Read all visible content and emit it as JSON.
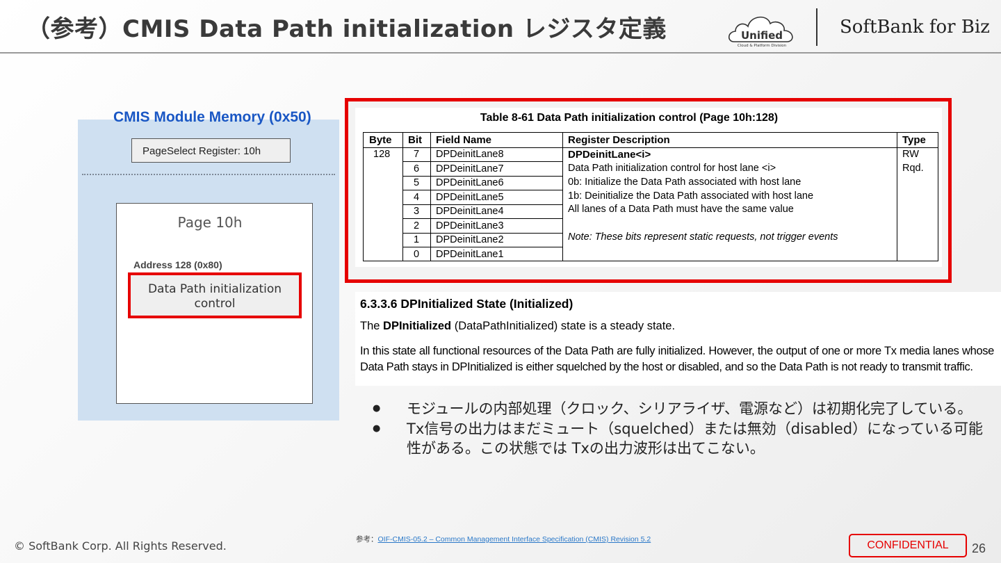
{
  "header": {
    "title": "（参考）CMIS Data Path initialization レジスタ定義",
    "logo_unified_text": "Unified",
    "logo_unified_sub": "Cloud & Platform Division",
    "logo_softbank": "SoftBank for Biz"
  },
  "memory_diagram": {
    "title": "CMIS Module Memory (0x50)",
    "pageselect": "PageSelect Register: 10h",
    "page_label": "Page 10h",
    "address_label": "Address 128 (0x80)",
    "box_lines": [
      "Data Path initialization",
      "control"
    ]
  },
  "register_table": {
    "caption": "Table 8-61 Data Path initialization control (Page 10h:128)",
    "headers": [
      "Byte",
      "Bit",
      "Field Name",
      "Register Description",
      "Type"
    ],
    "byte": "128",
    "rows": [
      {
        "bit": "7",
        "field": "DPDeinitLane8"
      },
      {
        "bit": "6",
        "field": "DPDeinitLane7"
      },
      {
        "bit": "5",
        "field": "DPDeinitLane6"
      },
      {
        "bit": "4",
        "field": "DPDeinitLane5"
      },
      {
        "bit": "3",
        "field": "DPDeinitLane4"
      },
      {
        "bit": "2",
        "field": "DPDeinitLane3"
      },
      {
        "bit": "1",
        "field": "DPDeinitLane2"
      },
      {
        "bit": "0",
        "field": "DPDeinitLane1"
      }
    ],
    "description": [
      "DPDeinitLane<i>",
      "Data Path initialization control for host lane <i>",
      "0b: Initialize the Data Path associated with host lane",
      "1b: Deinitialize the Data Path associated with host lane",
      "All lanes of a Data Path must have the same value",
      "Note: These bits represent static requests, not trigger events"
    ],
    "type_lines": [
      "RW",
      "Rqd."
    ]
  },
  "spec": {
    "heading": "6.3.3.6   DPInitialized State (Initialized)",
    "p1_prefix": "The ",
    "p1_bold": "DPInitialized",
    "p1_suffix": " (DataPathInitialized) state is a steady state.",
    "p2": "In this state all functional resources of the Data Path are fully initialized. However, the output of one or more Tx media lanes whose Data Path stays in DPInitialized is either squelched by the host or disabled, and so the Data Path is not ready to transmit traffic."
  },
  "bullets": [
    "モジュールの内部処理（クロック、シリアライザ、電源など）は初期化完了している。",
    "Tx信号の出力はまだミュート（squelched）または無効（disabled）になっている可能性がある。この状態では Txの出力波形は出てこない。"
  ],
  "footer": {
    "copyright": "© SoftBank Corp. All Rights Reserved.",
    "ref_label": "参考：",
    "ref_link": "OIF-CMIS-05.2 – Common Management Interface Specification (CMIS) Revision 5.2",
    "confidential": "CONFIDENTIAL",
    "page_number": "26"
  },
  "colors": {
    "accent_red": "#e60000",
    "panel_blue": "#cfe0f1",
    "title_blue": "#1a57c4",
    "link_blue": "#2a78c8"
  }
}
